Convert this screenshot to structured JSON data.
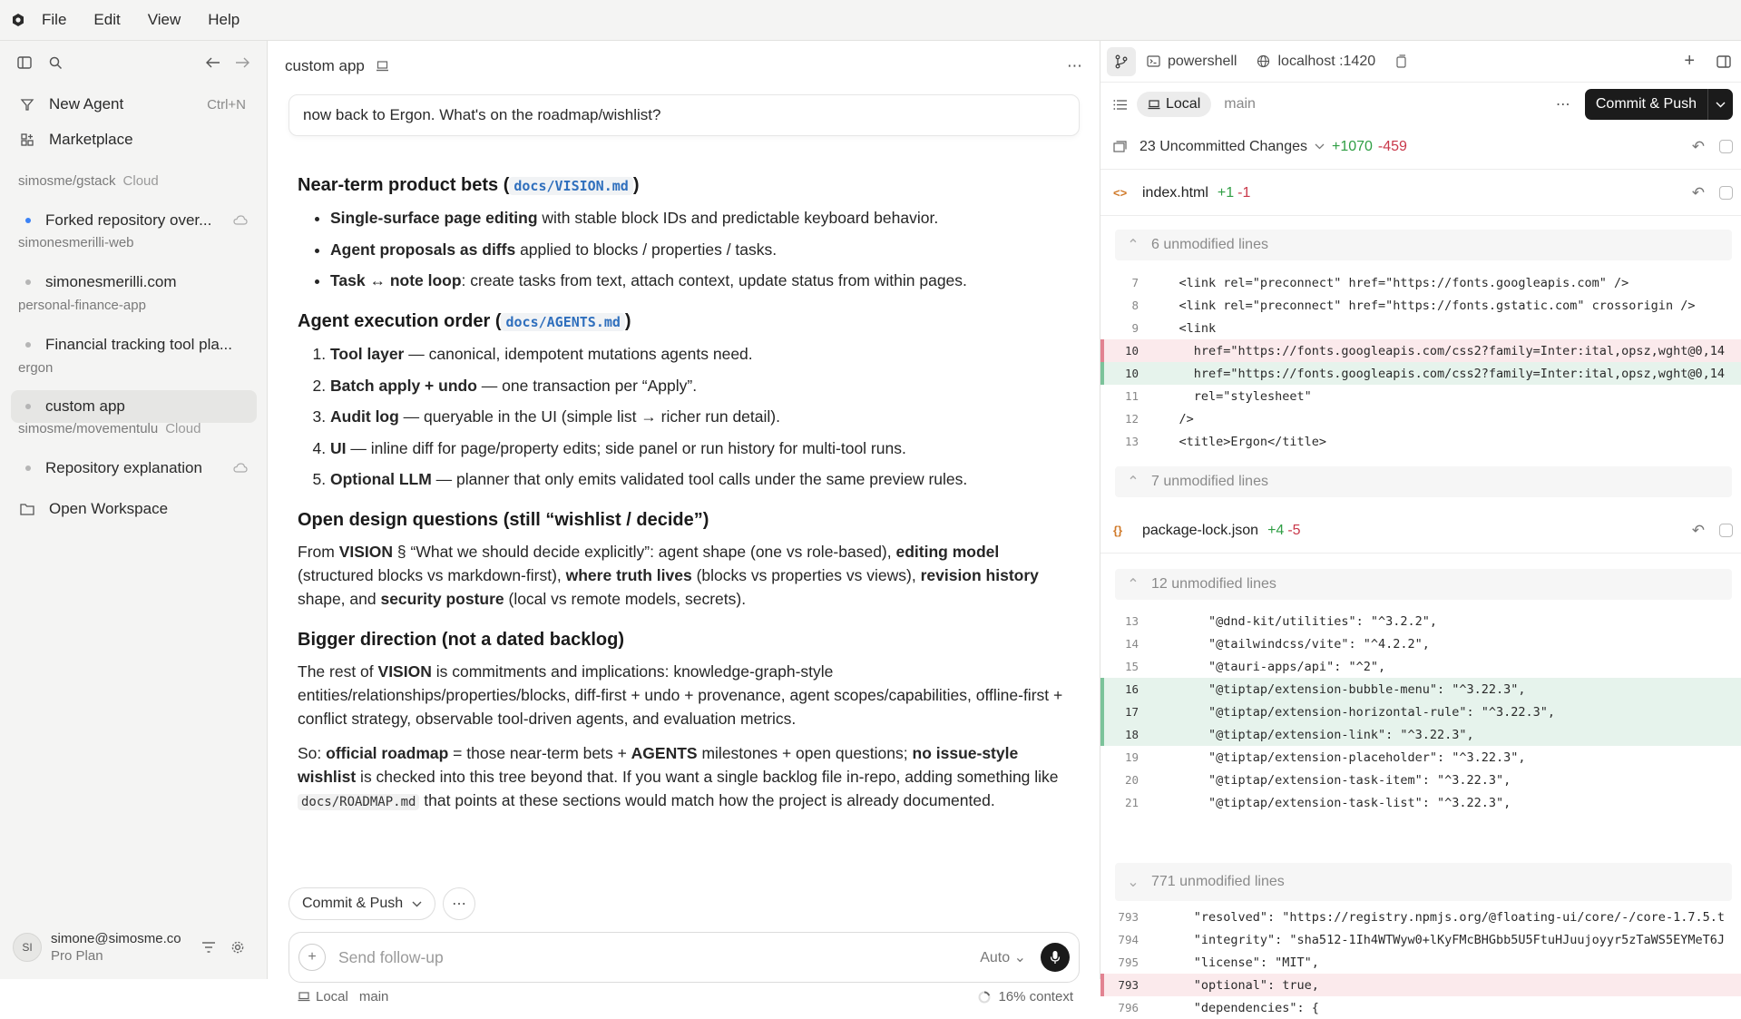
{
  "menubar": {
    "items": [
      "File",
      "Edit",
      "View",
      "Help"
    ]
  },
  "sidebar": {
    "new_agent": "New Agent",
    "new_agent_shortcut": "Ctrl+N",
    "marketplace": "Marketplace",
    "groups": [
      {
        "name": "simosme/gstack",
        "tag": "Cloud",
        "items": [
          {
            "label": "Forked repository over...",
            "active_dot": true,
            "cloud": true
          }
        ]
      },
      {
        "name": "simonesmerilli-web",
        "tag": "",
        "items": [
          {
            "label": "simonesmerilli.com"
          }
        ]
      },
      {
        "name": "personal-finance-app",
        "tag": "",
        "items": [
          {
            "label": "Financial tracking tool pla..."
          }
        ]
      },
      {
        "name": "ergon",
        "tag": "",
        "items": [
          {
            "label": "custom app",
            "selected": true
          }
        ]
      },
      {
        "name": "simosme/movementulu",
        "tag": "Cloud",
        "items": [
          {
            "label": "Repository explanation",
            "cloud": true
          }
        ]
      }
    ],
    "open_workspace": "Open Workspace",
    "user": {
      "initials": "SI",
      "email": "simone@simosme.co",
      "plan": "Pro Plan"
    }
  },
  "chat": {
    "title": "custom app",
    "user_message": "now back to Ergon. What's on the roadmap/wishlist?",
    "s1": {
      "title": "Near-term product bets (",
      "chip": "docs/VISION.md",
      "close": ")",
      "items": [
        {
          "bold": "Single-surface page editing",
          "rest": " with stable block IDs and predictable keyboard behavior."
        },
        {
          "bold": "Agent proposals as diffs",
          "rest": " applied to blocks / properties / tasks."
        },
        {
          "bold": "Task ↔ note loop",
          "rest": ": create tasks from text, attach context, update status from within pages."
        }
      ]
    },
    "s2": {
      "title": "Agent execution order (",
      "chip": "docs/AGENTS.md",
      "close": ")",
      "items": [
        {
          "bold": "Tool layer",
          "rest": " — canonical, idempotent mutations agents need."
        },
        {
          "bold": "Batch apply + undo",
          "rest": " — one transaction per “Apply”."
        },
        {
          "bold": "Audit log",
          "rest": " — queryable in the UI (simple list → richer run detail)."
        },
        {
          "bold": "UI",
          "rest": " — inline diff for page/property edits; side panel or run history for multi-tool runs."
        },
        {
          "bold": "Optional LLM",
          "rest": " — planner that only emits validated tool calls under the same preview rules."
        }
      ]
    },
    "s3": {
      "title": "Open design questions (still “wishlist / decide”)",
      "p": [
        "From ",
        "VISION",
        " § “What we should decide explicitly”: agent shape (one vs role-based), ",
        "editing model",
        " (structured blocks vs markdown-first), ",
        "where truth lives",
        " (blocks vs properties vs views), ",
        "revision history",
        " shape, and ",
        "security posture",
        " (local vs remote models, secrets)."
      ]
    },
    "s4": {
      "title": "Bigger direction (not a dated backlog)",
      "p1": [
        "The rest of ",
        "VISION",
        " is commitments and implications: knowledge-graph-style entities/relationships/properties/blocks, diff-first + undo + provenance, agent scopes/capabilities, offline-first + conflict strategy, observable tool-driven agents, and evaluation metrics."
      ],
      "p2": [
        "So: ",
        "official roadmap",
        " = those near-term bets + ",
        "AGENTS",
        " milestones + open questions; ",
        "no issue-style wishlist",
        " is checked into this tree beyond that. If you want a single backlog file in-repo, adding something like ",
        "docs/ROADMAP.md",
        " that points at these sections would match how the project is already documented."
      ]
    },
    "commit_push": "Commit & Push",
    "composer_placeholder": "Send follow-up",
    "mode": "Auto",
    "footer_local": "Local",
    "footer_branch": "main",
    "context": "16% context"
  },
  "diff": {
    "tabs": {
      "shell": "powershell",
      "host": "localhost :1420"
    },
    "local": "Local",
    "branch": "main",
    "commit_push": "Commit & Push",
    "changes": {
      "label": "23 Uncommitted Changes",
      "add": "+1070",
      "del": "-459"
    },
    "files": [
      {
        "name": "index.html",
        "add": "+1",
        "del": "-1",
        "icon": "<>"
      },
      {
        "name": "package-lock.json",
        "add": "+4",
        "del": "-5",
        "icon": "{}"
      }
    ],
    "unmodified": [
      "6 unmodified lines",
      "7 unmodified lines",
      "12 unmodified lines",
      "771 unmodified lines"
    ],
    "index_lines": [
      {
        "n": "7",
        "t": "    <link rel=\"preconnect\" href=\"https://fonts.googleapis.com\" />",
        "k": ""
      },
      {
        "n": "8",
        "t": "    <link rel=\"preconnect\" href=\"https://fonts.gstatic.com\" crossorigin />",
        "k": ""
      },
      {
        "n": "9",
        "t": "    <link",
        "k": ""
      },
      {
        "n": "10",
        "t": "      href=\"https://fonts.googleapis.com/css2?family=Inter:ital,opsz,wght@0,14",
        "k": "rem"
      },
      {
        "n": "10",
        "t": "      href=\"https://fonts.googleapis.com/css2?family=Inter:ital,opsz,wght@0,14",
        "k": "ins"
      },
      {
        "n": "11",
        "t": "      rel=\"stylesheet\"",
        "k": ""
      },
      {
        "n": "12",
        "t": "    />",
        "k": ""
      },
      {
        "n": "13",
        "t": "    <title>Ergon</title>",
        "k": ""
      }
    ],
    "pkg_lines": [
      {
        "n": "13",
        "t": "        \"@dnd-kit/utilities\": \"^3.2.2\",",
        "k": ""
      },
      {
        "n": "14",
        "t": "        \"@tailwindcss/vite\": \"^4.2.2\",",
        "k": ""
      },
      {
        "n": "15",
        "t": "        \"@tauri-apps/api\": \"^2\",",
        "k": ""
      },
      {
        "n": "16",
        "t": "        \"@tiptap/extension-bubble-menu\": \"^3.22.3\",",
        "k": "ins"
      },
      {
        "n": "17",
        "t": "        \"@tiptap/extension-horizontal-rule\": \"^3.22.3\",",
        "k": "ins"
      },
      {
        "n": "18",
        "t": "        \"@tiptap/extension-link\": \"^3.22.3\",",
        "k": "ins"
      },
      {
        "n": "19",
        "t": "        \"@tiptap/extension-placeholder\": \"^3.22.3\",",
        "k": ""
      },
      {
        "n": "20",
        "t": "        \"@tiptap/extension-task-item\": \"^3.22.3\",",
        "k": ""
      },
      {
        "n": "21",
        "t": "        \"@tiptap/extension-task-list\": \"^3.22.3\",",
        "k": ""
      }
    ],
    "pkg_lines2": [
      {
        "n": "793",
        "t": "      \"resolved\": \"https://registry.npmjs.org/@floating-ui/core/-/core-1.7.5.t",
        "k": ""
      },
      {
        "n": "794",
        "t": "      \"integrity\": \"sha512-1Ih4WTWyw0+lKyFMcBHGbb5U5FtuHJuujoyyr5zTaWS5EYMeT6J",
        "k": ""
      },
      {
        "n": "795",
        "t": "      \"license\": \"MIT\",",
        "k": ""
      },
      {
        "n": "793",
        "t": "      \"optional\": true,",
        "k": "rem"
      },
      {
        "n": "796",
        "t": "      \"dependencies\": {",
        "k": ""
      }
    ]
  }
}
